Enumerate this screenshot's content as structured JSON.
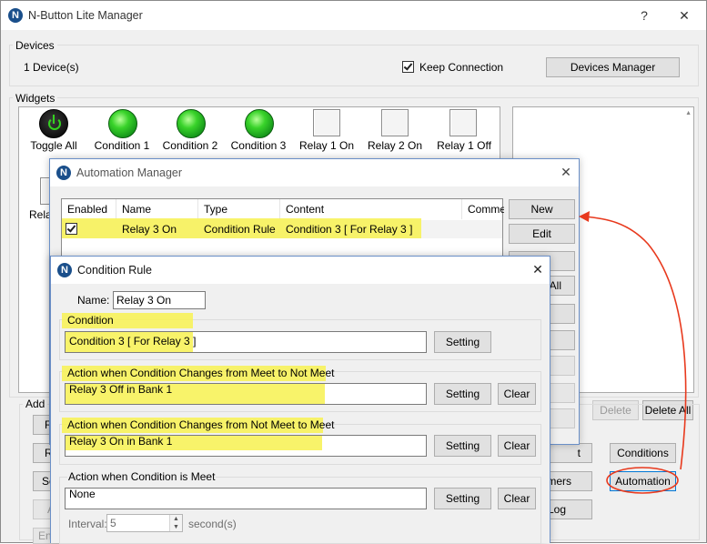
{
  "main": {
    "title": "N-Button Lite Manager",
    "help_glyph": "?",
    "close_glyph": "✕",
    "devices": {
      "group_label": "Devices",
      "count_text": "1 Device(s)",
      "keep_connection_label": "Keep Connection",
      "keep_connection_checked": true,
      "devices_manager_button": "Devices Manager"
    },
    "widgets": {
      "group_label": "Widgets",
      "items": [
        {
          "label": "Toggle All",
          "kind": "power"
        },
        {
          "label": "Condition 1",
          "kind": "green"
        },
        {
          "label": "Condition 2",
          "kind": "green"
        },
        {
          "label": "Condition 3",
          "kind": "green"
        },
        {
          "label": "Relay 1 On",
          "kind": "square"
        },
        {
          "label": "Relay 2 On",
          "kind": "square"
        },
        {
          "label": "Relay 1 Off",
          "kind": "square"
        }
      ],
      "partial_label": "Rela",
      "delete_button": "Delete",
      "delete_all_button": "Delete All"
    },
    "add": {
      "group_label": "Add",
      "left_buttons": [
        "R",
        "R",
        "Sc",
        "A",
        "Ent"
      ],
      "conditions_button": "Conditions",
      "automation_button": "Automation",
      "partial_t": "t",
      "partial_mers": "mers",
      "partial_log": "Log"
    }
  },
  "automation_manager": {
    "title": "Automation Manager",
    "close_glyph": "✕",
    "columns": [
      "Enabled",
      "Name",
      "Type",
      "Content",
      "Commen"
    ],
    "rows": [
      {
        "enabled": true,
        "name": "Relay 3 On",
        "type": "Condition Rule",
        "content": "Condition 3 [ For Relay 3 ]"
      }
    ],
    "buttons": {
      "new": "New",
      "edit": "Edit",
      "partial_e": "e",
      "partial_all": "All",
      "partial_y": "y"
    }
  },
  "condition_rule": {
    "title": "Condition Rule",
    "close_glyph": "✕",
    "name_label": "Name:",
    "name_value": "Relay 3 On",
    "sections": [
      {
        "label": "Condition",
        "value": "Condition 3 [ For Relay 3 ]",
        "has_clear": false,
        "setting": "Setting",
        "clear": ""
      },
      {
        "label": "Action when Condition Changes from Meet to Not Meet",
        "value": " Relay 3 Off in Bank 1",
        "has_clear": true,
        "setting": "Setting",
        "clear": "Clear"
      },
      {
        "label": "Action when Condition Changes from Not Meet to Meet",
        "value": "Relay 3 On in Bank 1",
        "has_clear": true,
        "setting": "Setting",
        "clear": "Clear"
      },
      {
        "label": "Action when Condition is Meet",
        "value": "None",
        "has_clear": true,
        "setting": "Setting",
        "clear": "Clear"
      }
    ],
    "interval_label": "Interval:",
    "interval_value": "5",
    "interval_unit": "second(s)"
  },
  "colors": {
    "highlight": "#f7f25a",
    "annotation": "#e8391d",
    "dialog_border": "#6a8fc7",
    "focus": "#0078d7"
  }
}
